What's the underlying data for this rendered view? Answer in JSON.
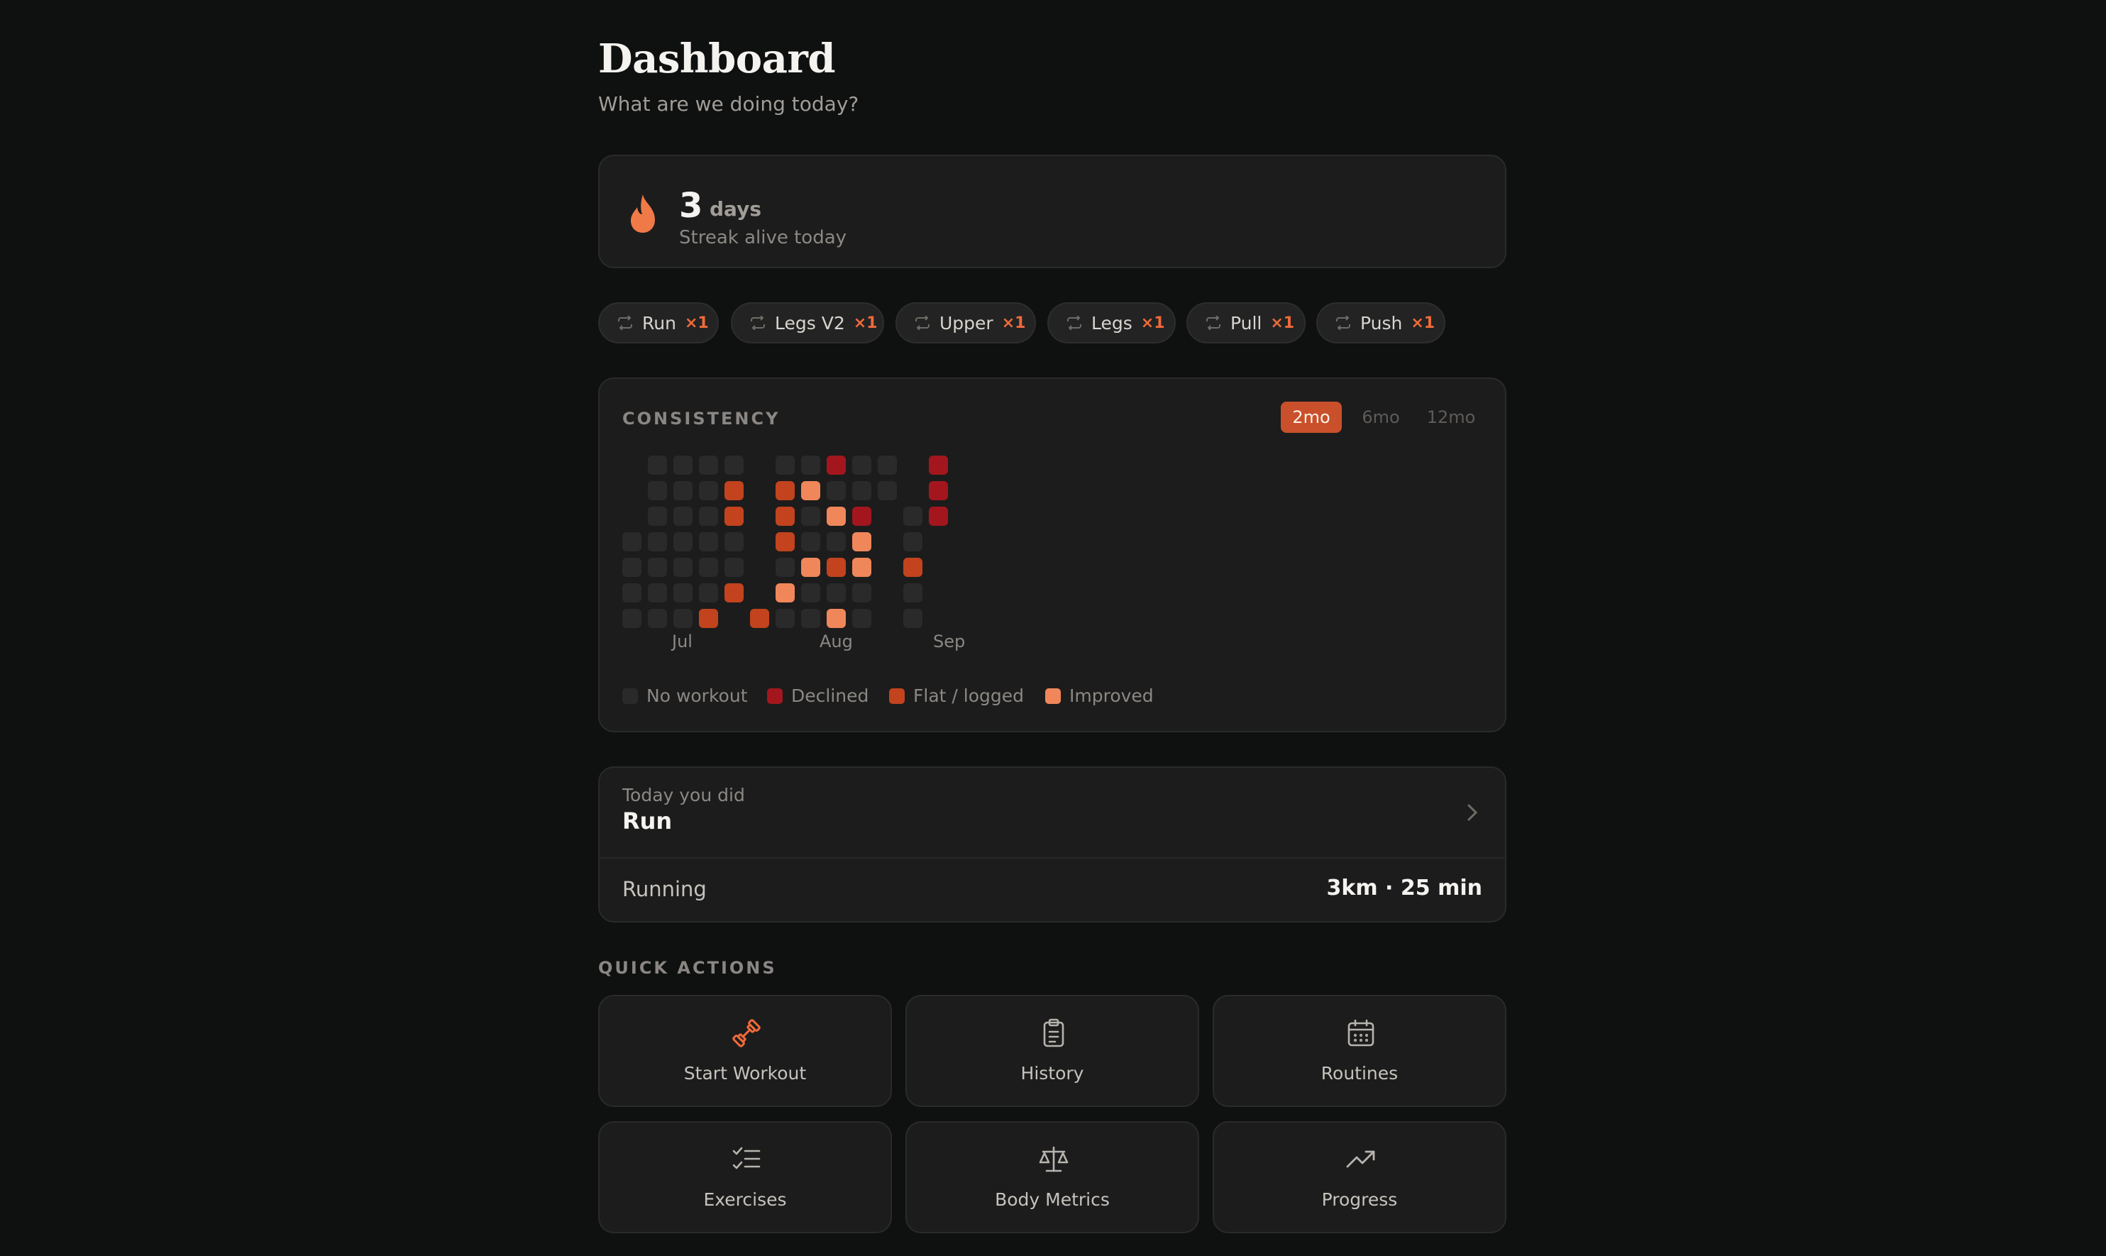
{
  "header": {
    "title": "Dashboard",
    "subtitle": "What are we doing today?"
  },
  "streak": {
    "count": "3",
    "unit": "days",
    "status": "Streak alive today",
    "icon": "flame-icon"
  },
  "routine_chips": [
    {
      "label": "Run",
      "count": "×1"
    },
    {
      "label": "Legs V2",
      "count": "×1"
    },
    {
      "label": "Upper",
      "count": "×1"
    },
    {
      "label": "Legs",
      "count": "×1"
    },
    {
      "label": "Pull",
      "count": "×1"
    },
    {
      "label": "Push",
      "count": "×1"
    }
  ],
  "consistency": {
    "title": "CONSISTENCY",
    "ranges": [
      "2mo",
      "6mo",
      "12mo"
    ],
    "selected_range": "2mo",
    "months": [
      "Jul",
      "Aug",
      "Sep"
    ],
    "legend": [
      {
        "label": "No workout",
        "color": "#2a2a2a"
      },
      {
        "label": "Declined",
        "color": "#a3161e"
      },
      {
        "label": "Flat / logged",
        "color": "#c2431d"
      },
      {
        "label": "Improved",
        "color": "#f0875a"
      }
    ],
    "grid_legend": "0 = no workout, 1 = declined, 2 = flat / logged, 3 = improved, -1 = blank",
    "weeks": [
      [
        -1,
        -1,
        -1,
        0,
        0,
        0,
        0
      ],
      [
        0,
        0,
        0,
        0,
        0,
        0,
        0
      ],
      [
        0,
        0,
        0,
        0,
        0,
        0,
        0
      ],
      [
        0,
        0,
        0,
        0,
        0,
        0,
        2
      ],
      [
        0,
        2,
        2,
        0,
        0,
        2,
        -1
      ],
      [
        -1,
        -1,
        -1,
        -1,
        -1,
        -1,
        2
      ],
      [
        0,
        2,
        2,
        2,
        0,
        3,
        0
      ],
      [
        0,
        3,
        0,
        0,
        3,
        0,
        0
      ],
      [
        1,
        0,
        3,
        0,
        2,
        0,
        3
      ],
      [
        0,
        0,
        1,
        3,
        3,
        0,
        0
      ],
      [
        0,
        0,
        -1,
        -1,
        -1,
        -1,
        -1
      ],
      [
        -1,
        -1,
        0,
        0,
        2,
        0,
        0
      ],
      [
        1,
        1,
        1,
        -1,
        -1,
        -1,
        -1
      ]
    ]
  },
  "today": {
    "label": "Today you did",
    "routine": "Run",
    "exercise": "Running",
    "stat": "3km · 25 min"
  },
  "quick_actions": {
    "title": "QUICK ACTIONS",
    "items": [
      {
        "label": "Start Workout",
        "icon": "dumbbell-icon",
        "accent": "#ef6a3a"
      },
      {
        "label": "History",
        "icon": "clipboard-icon"
      },
      {
        "label": "Routines",
        "icon": "calendar-icon"
      },
      {
        "label": "Exercises",
        "icon": "checklist-icon"
      },
      {
        "label": "Body Metrics",
        "icon": "scale-icon"
      },
      {
        "label": "Progress",
        "icon": "trending-up-icon"
      }
    ]
  }
}
